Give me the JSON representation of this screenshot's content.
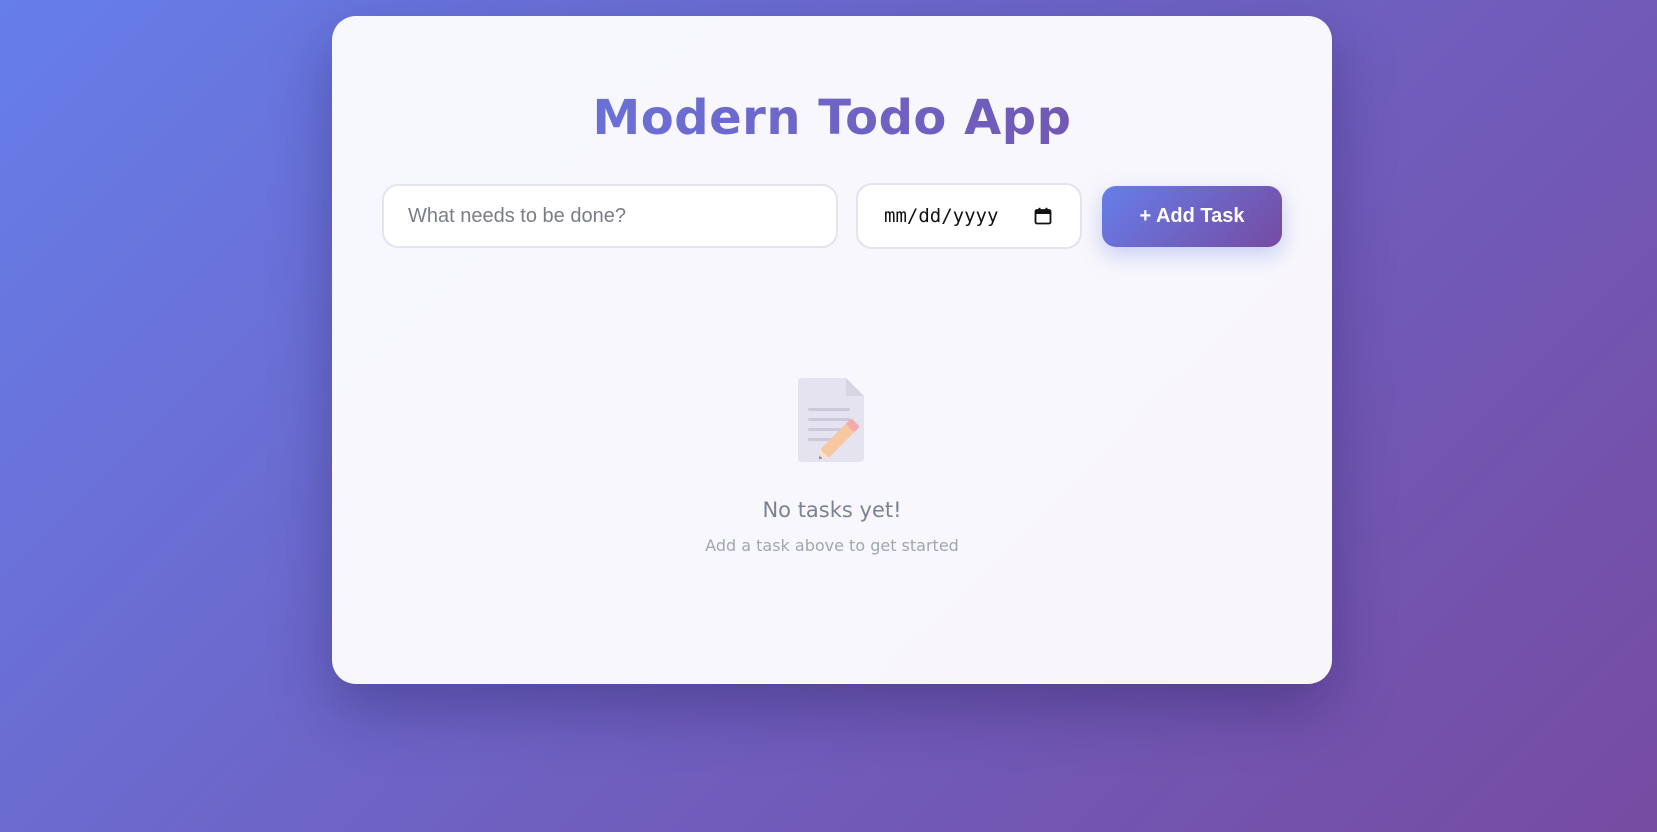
{
  "app": {
    "title": "Modern Todo App"
  },
  "form": {
    "task_placeholder": "What needs to be done?",
    "task_value": "",
    "date_placeholder": "mm/dd/yyyy",
    "add_button_label": "+ Add Task"
  },
  "empty_state": {
    "icon": "memo-icon",
    "title": "No tasks yet!",
    "subtitle": "Add a task above to get started"
  },
  "colors": {
    "gradient_start": "#667eea",
    "gradient_end": "#764ba2",
    "card_background": "#f7f7fc",
    "muted_text": "#7b8290"
  },
  "icons": {
    "date_picker": "calendar-icon",
    "empty": "memo-icon"
  }
}
